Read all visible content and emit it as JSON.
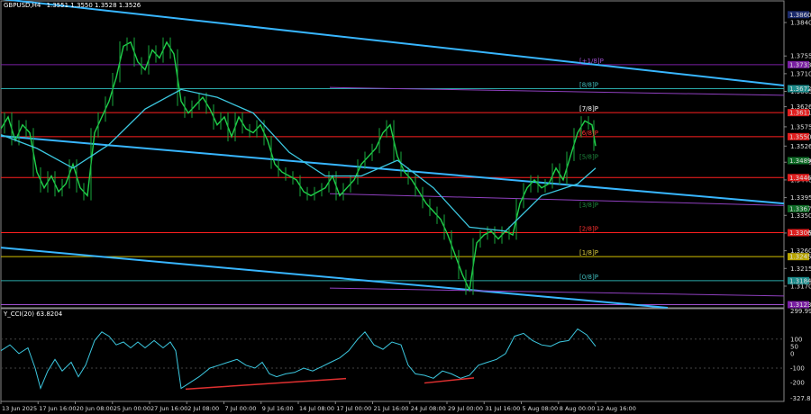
{
  "main_header": {
    "symbol": "GBPUSD,H4",
    "ohlc": "1.3551 1.3550 1.3528 1.3526"
  },
  "indicator_header": {
    "name": "Y_CCI(20) 63.8204"
  },
  "chart_data": [
    {
      "type": "line",
      "title": "GBPUSD,H4",
      "ylim": [
        1.3115,
        1.3895
      ],
      "price_axis_labels": [
        "1.3840",
        "1.3755",
        "1.3710",
        "1.3665",
        "1.3626",
        "1.3575",
        "1.3526",
        "1.3485",
        "1.3440",
        "1.3395",
        "1.3350",
        "1.3305",
        "1.3260",
        "1.3215",
        "1.3170"
      ],
      "level_tags": [
        {
          "text": "1.3860",
          "value": 1.386,
          "color": "#1b2a6b"
        },
        {
          "text": "1.3733",
          "value": 1.3733,
          "color": "#7a1fa2"
        },
        {
          "text": "1.3672",
          "value": 1.3672,
          "color": "#1c8a8a"
        },
        {
          "text": "1.3611",
          "value": 1.3611,
          "color": "#e01e1e"
        },
        {
          "text": "1.3550",
          "value": 1.355,
          "color": "#e01e1e"
        },
        {
          "text": "1.3489",
          "value": 1.3489,
          "color": "#0e6b26"
        },
        {
          "text": "1.3446",
          "value": 1.3446,
          "color": "#e01e1e"
        },
        {
          "text": "1.3367",
          "value": 1.3367,
          "color": "#0e6b26"
        },
        {
          "text": "1.3306",
          "value": 1.3306,
          "color": "#e01e1e"
        },
        {
          "text": "1.3245",
          "value": 1.3245,
          "color": "#b8a400"
        },
        {
          "text": "1.3184",
          "value": 1.3184,
          "color": "#1c8a8a"
        },
        {
          "text": "1.3123",
          "value": 1.3123,
          "color": "#7a1fa2"
        }
      ],
      "murray_labels": [
        {
          "text": "[+1/8]P",
          "value": 1.3733,
          "color": "#a050d0"
        },
        {
          "text": "[8/8]P",
          "value": 1.3672,
          "color": "#40c0c0"
        },
        {
          "text": "[7/8]P",
          "value": 1.3611,
          "color": "#ffffff"
        },
        {
          "text": "[6/8]P",
          "value": 1.355,
          "color": "#ff3030"
        },
        {
          "text": "[5/8]P",
          "value": 1.3489,
          "color": "#1e8a3e"
        },
        {
          "text": "[3/8]P",
          "value": 1.3367,
          "color": "#1e8a3e"
        },
        {
          "text": "[2/8]P",
          "value": 1.3306,
          "color": "#ff3030"
        },
        {
          "text": "[1/8]P",
          "value": 1.3245,
          "color": "#e0d040"
        },
        {
          "text": "[0/8]P",
          "value": 1.3184,
          "color": "#40c0c0"
        }
      ],
      "horizontal_lines": [
        {
          "value": 1.3733,
          "color": "#7a1fa2"
        },
        {
          "value": 1.3672,
          "color": "#2aa8a8"
        },
        {
          "value": 1.3611,
          "color": "#ff2020"
        },
        {
          "value": 1.355,
          "color": "#ff2020"
        },
        {
          "value": 1.3446,
          "color": "#ff2020"
        },
        {
          "value": 1.3306,
          "color": "#ff2020"
        },
        {
          "value": 1.3245,
          "color": "#d4c000"
        },
        {
          "value": 1.3184,
          "color": "#2aa8a8"
        },
        {
          "value": 1.3123,
          "color": "#a050d0"
        }
      ],
      "x_labels": [
        "13 Jun 2025",
        "17 Jun 16:00",
        "20 Jun 08:00",
        "25 Jun 00:00",
        "27 Jun 16:00",
        "2 Jul 08:00",
        "7 Jul 00:00",
        "9 Jul 16:00",
        "14 Jul 08:00",
        "17 Jul 00:00",
        "21 Jul 16:00",
        "24 Jul 08:00",
        "29 Jul 00:00",
        "31 Jul 16:00",
        "5 Aug 08:00",
        "8 Aug 00:00",
        "12 Aug 16:00"
      ],
      "price_path": [
        [
          0,
          1.357
        ],
        [
          8,
          1.36
        ],
        [
          16,
          1.354
        ],
        [
          24,
          1.358
        ],
        [
          32,
          1.356
        ],
        [
          40,
          1.346
        ],
        [
          48,
          1.342
        ],
        [
          56,
          1.345
        ],
        [
          64,
          1.341
        ],
        [
          72,
          1.343
        ],
        [
          80,
          1.348
        ],
        [
          88,
          1.342
        ],
        [
          96,
          1.34
        ],
        [
          104,
          1.356
        ],
        [
          112,
          1.36
        ],
        [
          120,
          1.364
        ],
        [
          128,
          1.37
        ],
        [
          136,
          1.378
        ],
        [
          144,
          1.379
        ],
        [
          152,
          1.374
        ],
        [
          160,
          1.372
        ],
        [
          168,
          1.377
        ],
        [
          176,
          1.375
        ],
        [
          184,
          1.379
        ],
        [
          192,
          1.376
        ],
        [
          200,
          1.364
        ],
        [
          208,
          1.361
        ],
        [
          216,
          1.363
        ],
        [
          224,
          1.365
        ],
        [
          232,
          1.362
        ],
        [
          240,
          1.358
        ],
        [
          248,
          1.36
        ],
        [
          256,
          1.355
        ],
        [
          264,
          1.36
        ],
        [
          272,
          1.357
        ],
        [
          280,
          1.356
        ],
        [
          288,
          1.358
        ],
        [
          296,
          1.354
        ],
        [
          304,
          1.348
        ],
        [
          312,
          1.346
        ],
        [
          320,
          1.345
        ],
        [
          328,
          1.344
        ],
        [
          336,
          1.341
        ],
        [
          344,
          1.34
        ],
        [
          352,
          1.341
        ],
        [
          360,
          1.342
        ],
        [
          368,
          1.345
        ],
        [
          376,
          1.34
        ],
        [
          384,
          1.342
        ],
        [
          392,
          1.344
        ],
        [
          400,
          1.348
        ],
        [
          408,
          1.35
        ],
        [
          416,
          1.352
        ],
        [
          424,
          1.356
        ],
        [
          432,
          1.358
        ],
        [
          440,
          1.35
        ],
        [
          448,
          1.346
        ],
        [
          456,
          1.344
        ],
        [
          464,
          1.341
        ],
        [
          472,
          1.338
        ],
        [
          480,
          1.336
        ],
        [
          488,
          1.334
        ],
        [
          496,
          1.33
        ],
        [
          504,
          1.325
        ],
        [
          512,
          1.32
        ],
        [
          520,
          1.316
        ],
        [
          528,
          1.328
        ],
        [
          536,
          1.33
        ],
        [
          544,
          1.331
        ],
        [
          552,
          1.329
        ],
        [
          560,
          1.331
        ],
        [
          568,
          1.33
        ],
        [
          576,
          1.338
        ],
        [
          584,
          1.342
        ],
        [
          592,
          1.344
        ],
        [
          600,
          1.342
        ],
        [
          608,
          1.343
        ],
        [
          616,
          1.347
        ],
        [
          624,
          1.344
        ],
        [
          632,
          1.35
        ],
        [
          640,
          1.356
        ],
        [
          648,
          1.359
        ],
        [
          656,
          1.358
        ],
        [
          660,
          1.3526
        ]
      ],
      "ma_path": [
        [
          0,
          1.3555
        ],
        [
          40,
          1.352
        ],
        [
          80,
          1.347
        ],
        [
          120,
          1.353
        ],
        [
          160,
          1.362
        ],
        [
          200,
          1.367
        ],
        [
          240,
          1.365
        ],
        [
          280,
          1.361
        ],
        [
          320,
          1.351
        ],
        [
          360,
          1.345
        ],
        [
          400,
          1.345
        ],
        [
          440,
          1.349
        ],
        [
          480,
          1.342
        ],
        [
          520,
          1.332
        ],
        [
          560,
          1.331
        ],
        [
          600,
          1.34
        ],
        [
          640,
          1.343
        ],
        [
          660,
          1.347
        ]
      ],
      "trend_lines": [
        {
          "from": [
            0,
            1.39
          ],
          "to": [
            869,
            1.368
          ],
          "color": "#38b6ff"
        },
        {
          "from": [
            0,
            1.3552
          ],
          "to": [
            869,
            1.338
          ],
          "color": "#38b6ff"
        },
        {
          "from": [
            0,
            1.3268
          ],
          "to": [
            740,
            1.3115
          ],
          "color": "#38b6ff"
        }
      ],
      "purple_lines": [
        {
          "from": [
            365,
            1.3675
          ],
          "to": [
            869,
            1.3655
          ],
          "color": "#9040c0"
        },
        {
          "from": [
            365,
            1.3405
          ],
          "to": [
            869,
            1.3375
          ],
          "color": "#9040c0"
        },
        {
          "from": [
            365,
            1.3165
          ],
          "to": [
            869,
            1.3145
          ],
          "color": "#9040c0"
        }
      ]
    },
    {
      "type": "line",
      "title": "Y_CCI(20) 63.8204",
      "ylim": [
        -330,
        310
      ],
      "y_labels": [
        "299.9969",
        "100",
        "50",
        "0",
        "-100",
        "-200",
        "-327.8322"
      ],
      "cci_path": [
        [
          0,
          20
        ],
        [
          10,
          60
        ],
        [
          20,
          0
        ],
        [
          30,
          40
        ],
        [
          38,
          -100
        ],
        [
          44,
          -240
        ],
        [
          52,
          -120
        ],
        [
          60,
          -40
        ],
        [
          68,
          -120
        ],
        [
          78,
          -60
        ],
        [
          86,
          -160
        ],
        [
          94,
          -80
        ],
        [
          104,
          90
        ],
        [
          112,
          150
        ],
        [
          120,
          120
        ],
        [
          128,
          60
        ],
        [
          136,
          80
        ],
        [
          144,
          40
        ],
        [
          152,
          80
        ],
        [
          160,
          40
        ],
        [
          170,
          90
        ],
        [
          180,
          40
        ],
        [
          188,
          80
        ],
        [
          194,
          20
        ],
        [
          200,
          -240
        ],
        [
          210,
          -200
        ],
        [
          220,
          -160
        ],
        [
          232,
          -100
        ],
        [
          242,
          -80
        ],
        [
          252,
          -60
        ],
        [
          262,
          -40
        ],
        [
          272,
          -80
        ],
        [
          282,
          -100
        ],
        [
          290,
          -60
        ],
        [
          298,
          -140
        ],
        [
          306,
          -160
        ],
        [
          316,
          -140
        ],
        [
          326,
          -130
        ],
        [
          336,
          -100
        ],
        [
          346,
          -120
        ],
        [
          356,
          -90
        ],
        [
          366,
          -60
        ],
        [
          376,
          -30
        ],
        [
          386,
          20
        ],
        [
          396,
          100
        ],
        [
          404,
          150
        ],
        [
          414,
          60
        ],
        [
          424,
          30
        ],
        [
          434,
          80
        ],
        [
          444,
          60
        ],
        [
          452,
          -80
        ],
        [
          460,
          -140
        ],
        [
          470,
          -150
        ],
        [
          480,
          -170
        ],
        [
          490,
          -120
        ],
        [
          500,
          -140
        ],
        [
          510,
          -170
        ],
        [
          520,
          -150
        ],
        [
          530,
          -80
        ],
        [
          540,
          -60
        ],
        [
          550,
          -40
        ],
        [
          560,
          0
        ],
        [
          570,
          120
        ],
        [
          580,
          140
        ],
        [
          590,
          90
        ],
        [
          600,
          60
        ],
        [
          610,
          50
        ],
        [
          620,
          80
        ],
        [
          630,
          90
        ],
        [
          640,
          170
        ],
        [
          650,
          130
        ],
        [
          660,
          50
        ]
      ],
      "divergence_lines": [
        {
          "from": [
            205,
            -245
          ],
          "to": [
            383,
            -172
          ],
          "color": "#e03030"
        },
        {
          "from": [
            470,
            -203
          ],
          "to": [
            525,
            -168
          ],
          "color": "#e03030"
        }
      ]
    }
  ]
}
